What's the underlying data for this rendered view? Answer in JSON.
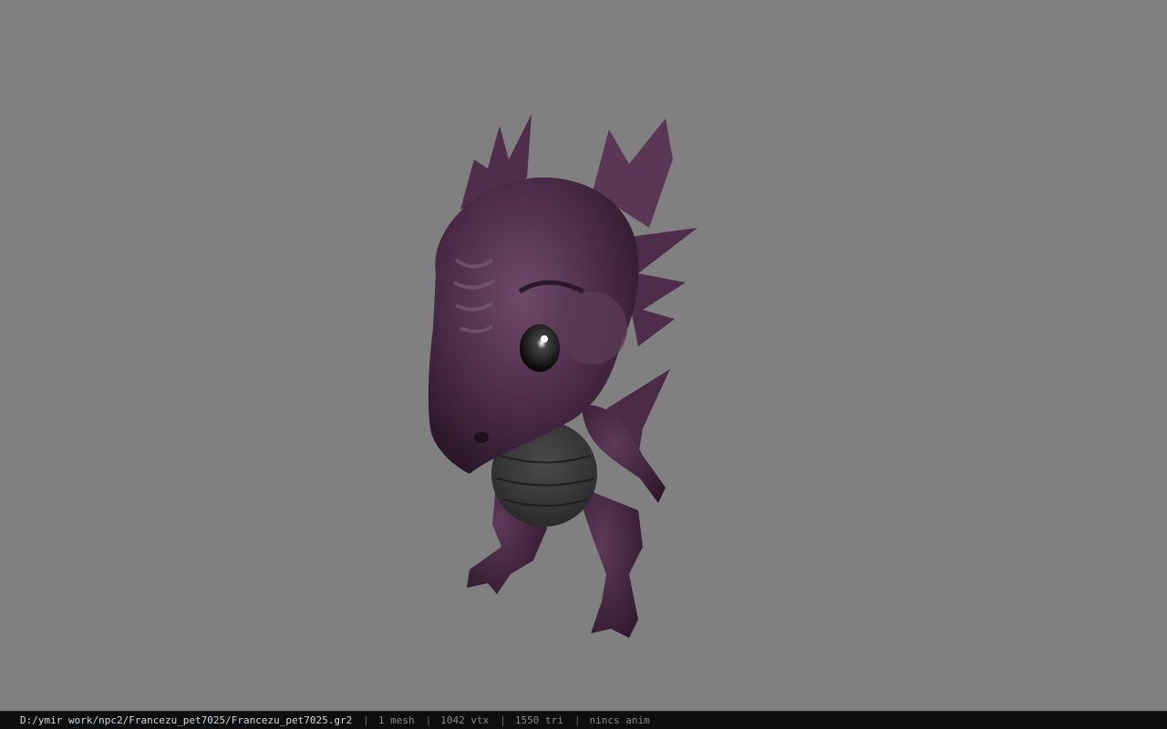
{
  "viewport": {
    "background_color": "#808080",
    "model_color": "#4a2a45",
    "belly_color": "#3a3a3a"
  },
  "status_bar": {
    "file_path": "D:/ymir work/npc2/Francezu_pet7025/Francezu_pet7025.gr2",
    "separator": "|",
    "mesh_count": "1 mesh",
    "vertex_count": "1042 vtx",
    "triangle_count": "1550 tri",
    "animation": "nincs anim"
  }
}
